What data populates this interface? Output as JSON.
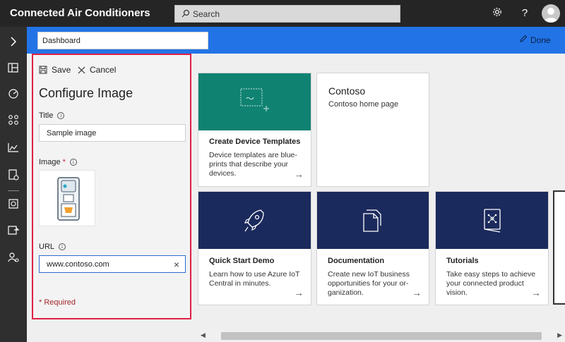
{
  "app": {
    "title": "Connected Air Conditioners"
  },
  "search": {
    "placeholder": "Search"
  },
  "header": {
    "dashboard_name": "Dashboard",
    "done_label": "Done"
  },
  "rail": {
    "items": [
      "expand",
      "dashboards",
      "device-explorer",
      "device-sets",
      "analytics",
      "jobs",
      "device-templates",
      "data-export",
      "administration"
    ]
  },
  "panel": {
    "save_label": "Save",
    "cancel_label": "Cancel",
    "heading": "Configure Image",
    "title_label": "Title",
    "title_value": "Sample image",
    "image_label": "Image",
    "image_required_mark": "*",
    "url_label": "URL",
    "url_value": "www.contoso.com",
    "required_note": "* Required"
  },
  "tiles": [
    {
      "title": "Create Device Templates",
      "desc": "Device templates are blue-prints that describe your devices.",
      "hero_color": "#108272",
      "icon": "device-template-icon"
    },
    {
      "title": "Contoso",
      "desc": "Contoso home page"
    },
    {
      "title": "Quick Start Demo",
      "desc": "Learn how to use Azure IoT Central in minutes.",
      "hero_color": "#1b2a5c",
      "icon": "rocket-icon"
    },
    {
      "title": "Documentation",
      "desc": "Create new IoT business opportunities for your or-ganization.",
      "hero_color": "#1b2a5c",
      "icon": "documents-icon"
    },
    {
      "title": "Tutorials",
      "desc": "Take easy steps to achieve your connected product vision.",
      "hero_color": "#1b2a5c",
      "icon": "book-icon"
    }
  ],
  "colors": {
    "topbar": "#252525",
    "rail": "#2f2f2f",
    "accent": "#2274e6",
    "panel_border": "#e02045",
    "required": "#a4262c"
  }
}
